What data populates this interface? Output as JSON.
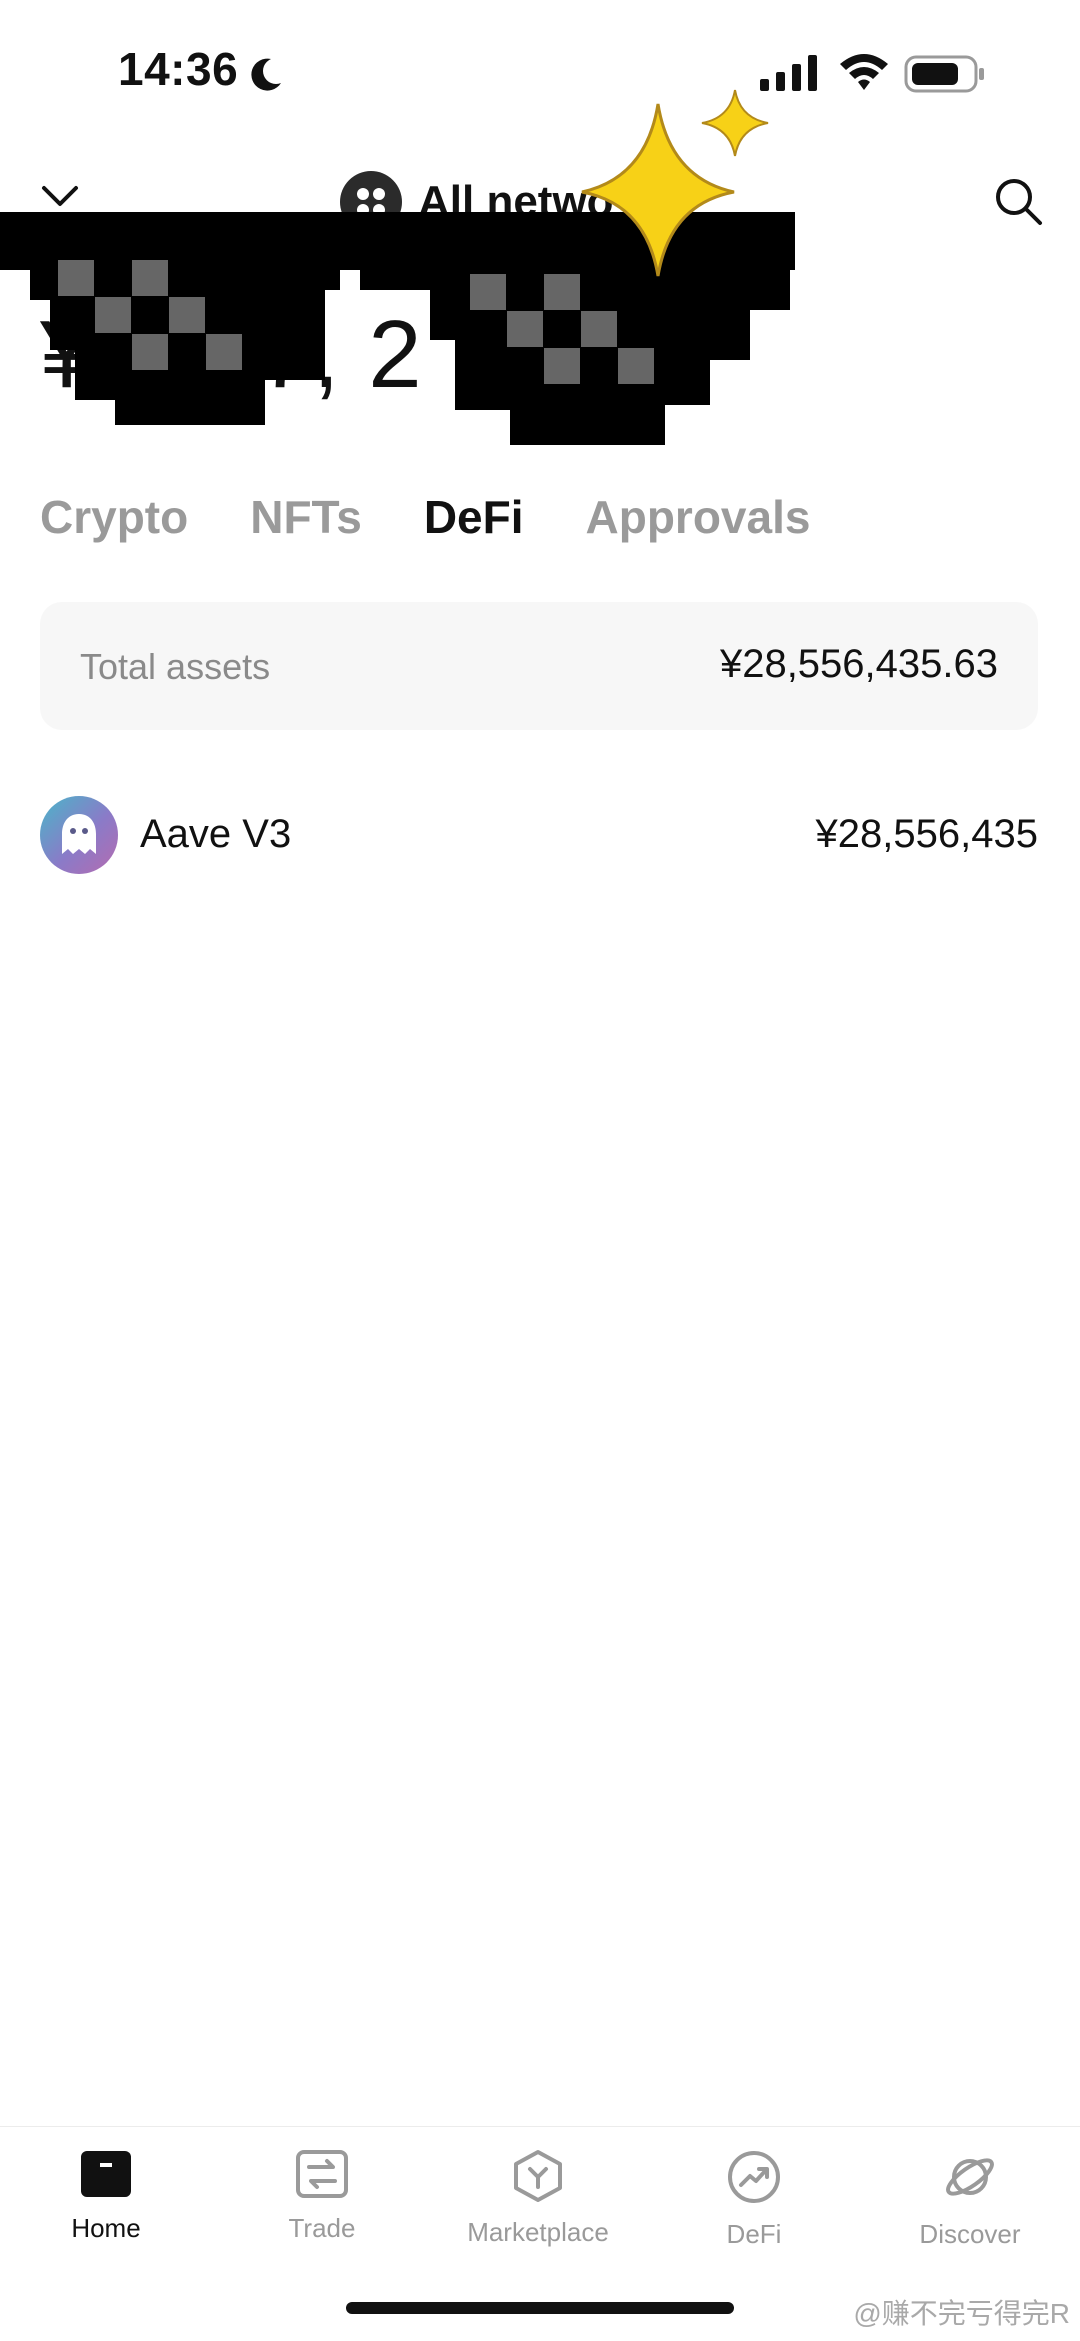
{
  "status_bar": {
    "time": "14:36"
  },
  "header": {
    "network_label": "All netwo",
    "balance_visible": "¥ ,717, 2"
  },
  "tabs": [
    {
      "label": "Crypto",
      "active": false
    },
    {
      "label": "NFTs",
      "active": false
    },
    {
      "label": "DeFi",
      "active": true
    },
    {
      "label": "Approvals",
      "active": false
    }
  ],
  "total_assets": {
    "label": "Total assets",
    "value": "¥28,556,435.63"
  },
  "protocols": [
    {
      "name": "Aave V3",
      "value": "¥28,556,435",
      "icon": "ghost-icon"
    }
  ],
  "bottom_nav": [
    {
      "label": "Home",
      "icon": "home-icon",
      "active": true
    },
    {
      "label": "Trade",
      "icon": "trade-icon",
      "active": false
    },
    {
      "label": "Marketplace",
      "icon": "marketplace-icon",
      "active": false
    },
    {
      "label": "DeFi",
      "icon": "defi-icon",
      "active": false
    },
    {
      "label": "Discover",
      "icon": "discover-icon",
      "active": false
    }
  ],
  "watermark": "@赚不完亏得完R",
  "colors": {
    "text_primary": "#111111",
    "text_secondary": "#9a9a9a",
    "card_bg": "#f7f7f7",
    "sparkle": "#f7d117"
  }
}
